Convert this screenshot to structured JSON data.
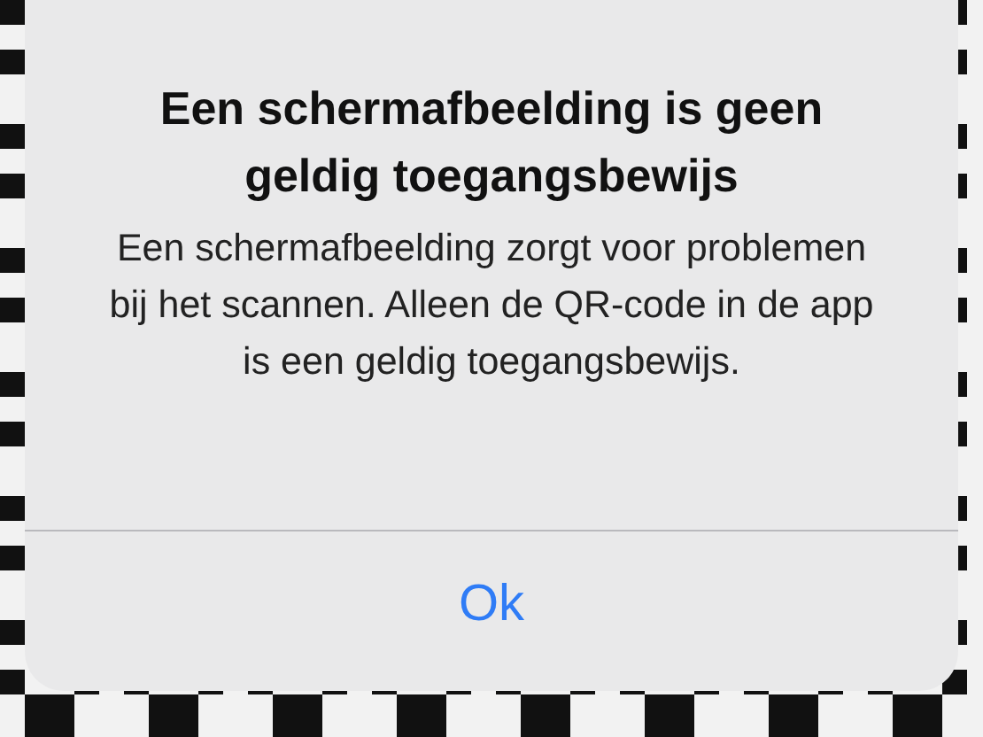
{
  "alert": {
    "title": "Een schermafbeelding is geen geldig toegangsbewijs",
    "message": "Een schermafbeelding zorgt voor problemen bij het scannen. Alleen de QR-code in de app is een geldig toegangsbewijs.",
    "buttons": [
      "Ok"
    ]
  }
}
